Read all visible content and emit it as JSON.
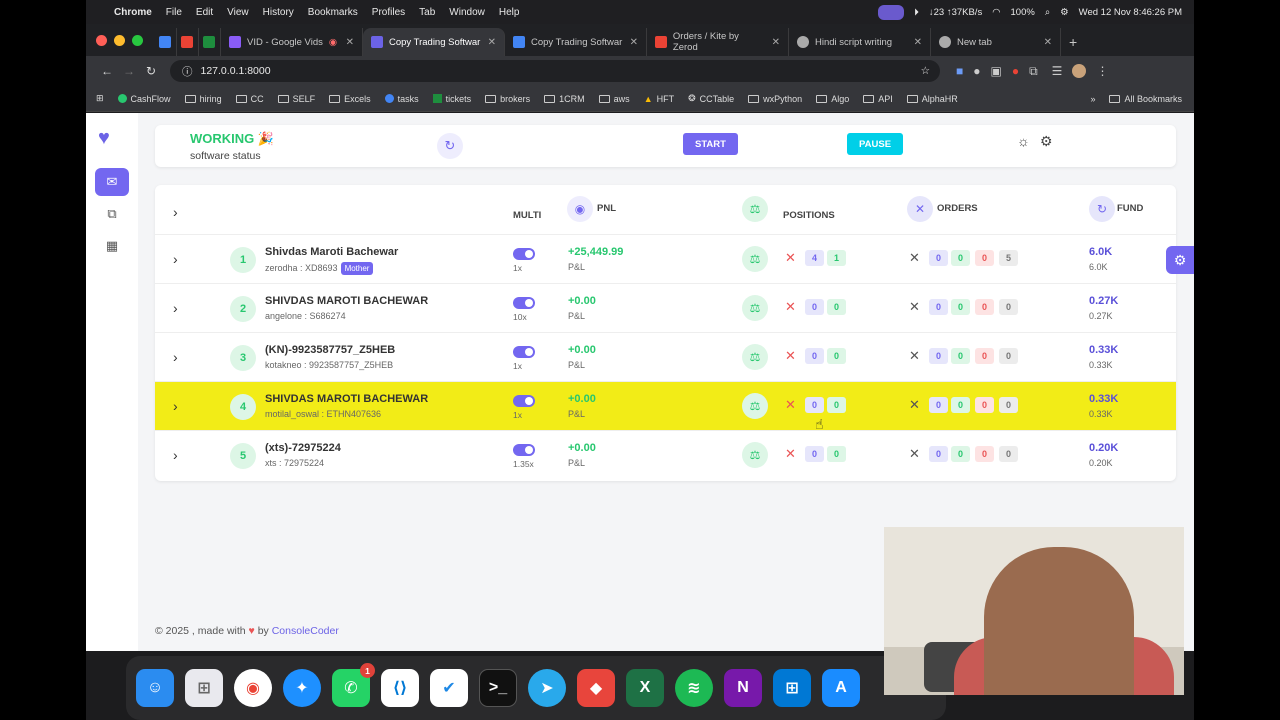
{
  "menubar": {
    "app": "Chrome",
    "items": [
      "File",
      "Edit",
      "View",
      "History",
      "Bookmarks",
      "Profiles",
      "Tab",
      "Window",
      "Help"
    ],
    "net": "↓23 ↑37KB/s",
    "battery": "100%",
    "clock": "Wed 12 Nov 8:46:26 PM"
  },
  "tabs": [
    {
      "label": "VID - Google Vids",
      "icon_color": "#8a5cf6"
    },
    {
      "label": "Copy Trading Softwar",
      "icon_color": "#6c63e6",
      "active": true
    },
    {
      "label": "Copy Trading Softwar",
      "icon_color": "#4285f4"
    },
    {
      "label": "Orders / Kite by Zerod",
      "icon_color": "#ea4335"
    },
    {
      "label": "Hindi script writing",
      "icon_color": "#aaaaaa"
    },
    {
      "label": "New tab",
      "icon_color": "#aaaaaa"
    }
  ],
  "address": {
    "url": "127.0.0.1:8000"
  },
  "bookmarks": [
    "CashFlow",
    "hiring",
    "CC",
    "SELF",
    "Excels",
    "tasks",
    "tickets",
    "brokers",
    "1CRM",
    "aws",
    "HFT",
    "CCTable",
    "wxPython",
    "Algo",
    "API",
    "AlphaHR"
  ],
  "bookmarks_all": "All Bookmarks",
  "status": {
    "title": "WORKING 🎉",
    "subtitle": "software status",
    "start": "START",
    "pause": "PAUSE"
  },
  "table": {
    "headers": {
      "multi": "MULTI",
      "pnl": "PNL",
      "positions": "POSITIONS",
      "orders": "ORDERS",
      "fund": "FUND"
    },
    "rows": [
      {
        "n": "1",
        "name": "Shivdas Maroti Bachewar",
        "sub": "zerodha : XD8693",
        "badge": "Mother",
        "mult": "1x",
        "pnl": "+25,449.99",
        "pl": "P&L",
        "pos": [
          "4",
          "1"
        ],
        "ord": [
          "0",
          "0",
          "0",
          "5"
        ],
        "fund": "6.0K",
        "fund_sub": "6.0K"
      },
      {
        "n": "2",
        "name": "SHIVDAS MAROTI BACHEWAR",
        "sub": "angelone : S686274",
        "badge": "",
        "mult": "10x",
        "pnl": "+0.00",
        "pl": "P&L",
        "pos": [
          "0",
          "0"
        ],
        "ord": [
          "0",
          "0",
          "0",
          "0"
        ],
        "fund": "0.27K",
        "fund_sub": "0.27K"
      },
      {
        "n": "3",
        "name": "(KN)-9923587757_Z5HEB",
        "sub": "kotakneo : 9923587757_Z5HEB",
        "badge": "",
        "mult": "1x",
        "pnl": "+0.00",
        "pl": "P&L",
        "pos": [
          "0",
          "0"
        ],
        "ord": [
          "0",
          "0",
          "0",
          "0"
        ],
        "fund": "0.33K",
        "fund_sub": "0.33K"
      },
      {
        "n": "4",
        "name": "SHIVDAS MAROTI BACHEWAR",
        "sub": "motilal_oswal : ETHN407636",
        "badge": "",
        "mult": "1x",
        "pnl": "+0.00",
        "pl": "P&L",
        "pos": [
          "0",
          "0"
        ],
        "ord": [
          "0",
          "0",
          "0",
          "0"
        ],
        "fund": "0.33K",
        "fund_sub": "0.33K",
        "highlight": true
      },
      {
        "n": "5",
        "name": "(xts)-72975224",
        "sub": "xts : 72975224",
        "badge": "",
        "mult": "1.35x",
        "pnl": "+0.00",
        "pl": "P&L",
        "pos": [
          "0",
          "0"
        ],
        "ord": [
          "0",
          "0",
          "0",
          "0"
        ],
        "fund": "0.20K",
        "fund_sub": "0.20K"
      }
    ]
  },
  "footer": {
    "prefix": "© 2025 , made with",
    "by": "by",
    "link": "ConsoleCoder"
  },
  "dock": {
    "whatsapp_badge": "1"
  }
}
